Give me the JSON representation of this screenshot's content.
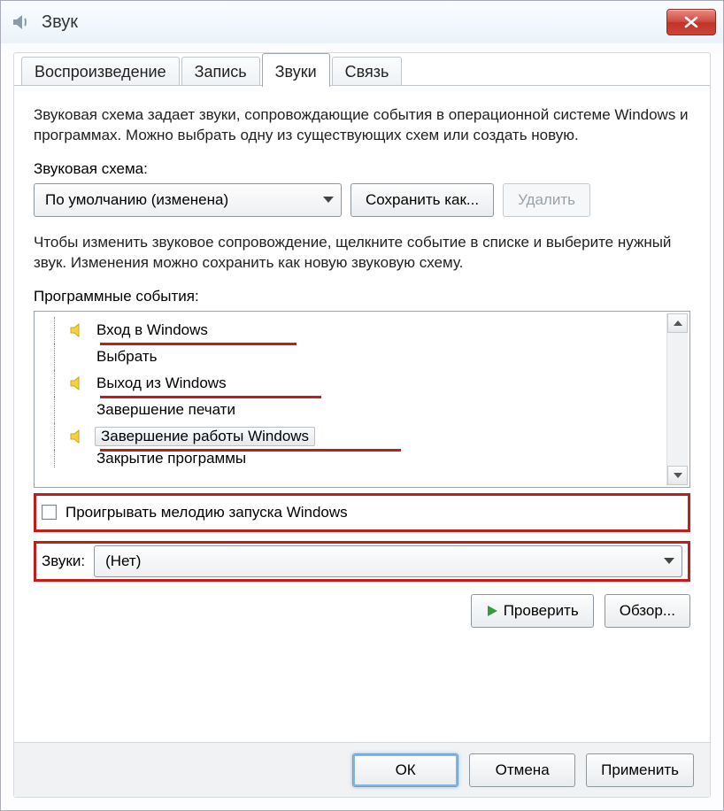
{
  "window": {
    "title": "Звук"
  },
  "tabs": {
    "playback": "Воспроизведение",
    "recording": "Запись",
    "sounds": "Звуки",
    "comm": "Связь"
  },
  "panel": {
    "intro": "Звуковая схема задает звуки, сопровождающие события в операционной системе Windows и программах. Можно выбрать одну из существующих схем или создать новую.",
    "scheme_label": "Звуковая схема:",
    "scheme_value": "По умолчанию (изменена)",
    "save_as": "Сохранить как...",
    "delete": "Удалить",
    "events_intro": "Чтобы изменить звуковое сопровождение, щелкните событие в списке и выберите нужный звук. Изменения можно сохранить как новую звуковую схему.",
    "events_label": "Программные события:",
    "events": [
      {
        "label": "Вход в Windows",
        "has_sound": true
      },
      {
        "label": "Выбрать",
        "has_sound": false
      },
      {
        "label": "Выход из Windows",
        "has_sound": true
      },
      {
        "label": "Завершение печати",
        "has_sound": false
      },
      {
        "label": "Завершение работы Windows",
        "has_sound": true,
        "selected": true
      },
      {
        "label": "Закрытие программы",
        "has_sound": false,
        "cut": true
      }
    ],
    "play_startup_label": "Проигрывать мелодию запуска Windows",
    "sounds_label": "Звуки:",
    "sounds_value": "(Нет)",
    "test": "Проверить",
    "browse": "Обзор..."
  },
  "buttons": {
    "ok": "ОК",
    "cancel": "Отмена",
    "apply": "Применить"
  }
}
